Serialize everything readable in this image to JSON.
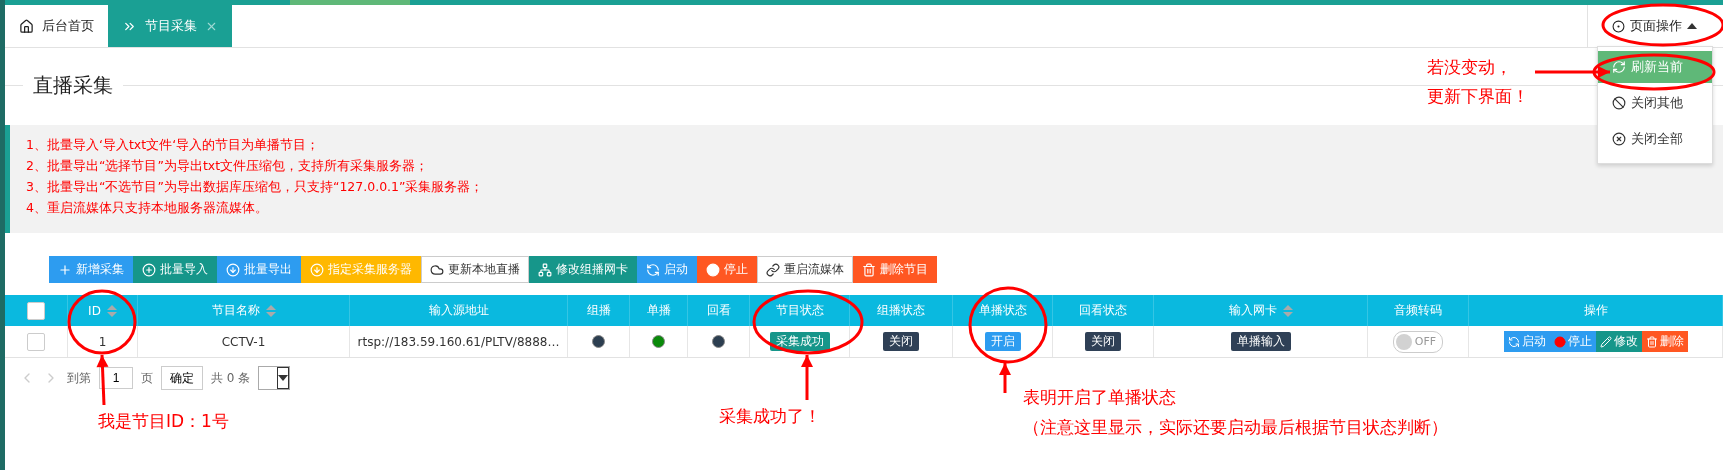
{
  "tabs": [
    {
      "label": "后台首页",
      "selected": false,
      "closable": false
    },
    {
      "label": "节目采集",
      "selected": true,
      "closable": true
    }
  ],
  "page_actions": {
    "label": "页面操作",
    "expanded": true,
    "items": [
      {
        "label": "刷新当前",
        "selected": true
      },
      {
        "label": "关闭其他",
        "selected": false
      },
      {
        "label": "关闭全部",
        "selected": false
      }
    ]
  },
  "title": "直播采集",
  "notices": [
    "1、批量导入‘导入txt文件‘导入的节目为单播节目；",
    "2、批量导出“选择节目”为导出txt文件压缩包，支持所有采集服务器；",
    "3、批量导出“不选节目”为导出数据库压缩包，只支持“127.0.0.1”采集服务器；",
    "4、重启流媒体只支持本地服务器流媒体。"
  ],
  "toolbar": [
    {
      "label": "新增采集",
      "color": "#2d9cf0"
    },
    {
      "label": "批量导入",
      "color": "#16968a"
    },
    {
      "label": "批量导出",
      "color": "#2d9cf0"
    },
    {
      "label": "指定采集服务器",
      "color": "#ffb800"
    },
    {
      "label": "更新本地直播",
      "color": "#ffffff"
    },
    {
      "label": "修改组播网卡",
      "color": "#16968a"
    },
    {
      "label": "启动",
      "color": "#2d9cf0"
    },
    {
      "label": "停止",
      "color": "#ff5722"
    },
    {
      "label": "重启流媒体",
      "color": "#ffffff"
    },
    {
      "label": "删除节目",
      "color": "#ff5722"
    }
  ],
  "table": {
    "header_checkbox": {
      "checked": false
    },
    "columns": [
      {
        "label": "ID",
        "sortable": true
      },
      {
        "label": "节目名称",
        "sortable": true
      },
      {
        "label": "输入源地址",
        "sortable": false
      },
      {
        "label": "组播",
        "sortable": false
      },
      {
        "label": "单播",
        "sortable": false
      },
      {
        "label": "回看",
        "sortable": false
      },
      {
        "label": "节目状态",
        "sortable": false
      },
      {
        "label": "组播状态",
        "sortable": false
      },
      {
        "label": "单播状态",
        "sortable": false
      },
      {
        "label": "回看状态",
        "sortable": false
      },
      {
        "label": "输入网卡",
        "sortable": true
      },
      {
        "label": "音频转码",
        "sortable": false
      },
      {
        "label": "操作",
        "sortable": false
      }
    ],
    "rows": [
      {
        "checked": false,
        "id": "1",
        "name": "CCTV-1",
        "source": "rtsp://183.59.160.61/PLTV/8888…",
        "dots": [
          {
            "color": "#2c3e50"
          },
          {
            "color": "#0a8a0a"
          },
          {
            "color": "#2c3e50"
          }
        ],
        "badges": [
          {
            "label": "采集成功",
            "color": "#16968a"
          },
          {
            "label": "关闭",
            "color": "#2f4056"
          },
          {
            "label": "开启",
            "color": "#2d9cf0"
          },
          {
            "label": "关闭",
            "color": "#2f4056"
          },
          {
            "label": "单播输入",
            "color": "#2f4056"
          }
        ],
        "audio": {
          "on": false,
          "label": "OFF"
        },
        "actions": [
          {
            "label": "启动",
            "color": "#2d9cf0"
          },
          {
            "label": "停止",
            "color": "#2d9cf0"
          },
          {
            "label": "修改",
            "color": "#16968a"
          },
          {
            "label": "删除",
            "color": "#ff5722"
          }
        ]
      }
    ]
  },
  "pager": {
    "goto": "到第",
    "page": "1",
    "page_unit": "页",
    "confirm": "确定",
    "total": "共 0 条"
  },
  "annotations": [
    "我是节目ID：1号",
    "采集成功了！",
    "表明开启了单播状态",
    "（注意这里显示，实际还要启动最后根据节目状态判断）",
    "若没变动，",
    "更新下界面！"
  ]
}
